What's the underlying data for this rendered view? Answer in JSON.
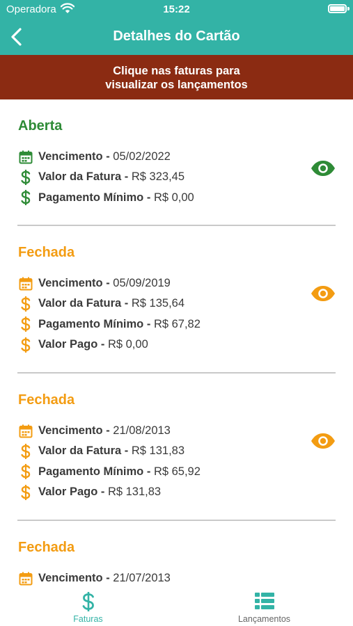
{
  "status_bar": {
    "carrier": "Operadora",
    "time": "15:22"
  },
  "header": {
    "title": "Detalhes do Cartão"
  },
  "banner": {
    "line1": "Clique nas faturas para",
    "line2": "visualizar os lançamentos"
  },
  "colors": {
    "teal": "#33b3a6",
    "banner": "#8b2b12",
    "open": "#2e8b36",
    "closed": "#f39c12"
  },
  "invoices": [
    {
      "status": "Aberta",
      "status_color": "#2e8b36",
      "rows": [
        {
          "icon": "calendar-icon",
          "label": "Vencimento - ",
          "value": "05/02/2022"
        },
        {
          "icon": "dollar-icon",
          "label": "Valor da Fatura - ",
          "value": "R$ 323,45"
        },
        {
          "icon": "dollar-icon",
          "label": "Pagamento Mínimo - ",
          "value": "R$ 0,00"
        }
      ]
    },
    {
      "status": "Fechada",
      "status_color": "#f39c12",
      "rows": [
        {
          "icon": "calendar-icon",
          "label": "Vencimento - ",
          "value": "05/09/2019"
        },
        {
          "icon": "dollar-icon",
          "label": "Valor da Fatura - ",
          "value": "R$ 135,64"
        },
        {
          "icon": "dollar-icon",
          "label": "Pagamento Mínimo - ",
          "value": "R$ 67,82"
        },
        {
          "icon": "dollar-icon",
          "label": "Valor Pago - ",
          "value": "R$ 0,00"
        }
      ]
    },
    {
      "status": "Fechada",
      "status_color": "#f39c12",
      "rows": [
        {
          "icon": "calendar-icon",
          "label": "Vencimento - ",
          "value": "21/08/2013"
        },
        {
          "icon": "dollar-icon",
          "label": "Valor da Fatura - ",
          "value": "R$ 131,83"
        },
        {
          "icon": "dollar-icon",
          "label": "Pagamento Mínimo - ",
          "value": "R$ 65,92"
        },
        {
          "icon": "dollar-icon",
          "label": "Valor Pago - ",
          "value": "R$ 131,83"
        }
      ]
    },
    {
      "status": "Fechada",
      "status_color": "#f39c12",
      "rows": [
        {
          "icon": "calendar-icon",
          "label": "Vencimento - ",
          "value": "21/07/2013"
        }
      ]
    }
  ],
  "tabbar": {
    "tabs": [
      {
        "label": "Faturas",
        "icon": "dollar-icon",
        "active": true,
        "color": "#33b3a6"
      },
      {
        "label": "Lançamentos",
        "icon": "list-icon",
        "active": false,
        "color": "#666666"
      }
    ]
  }
}
